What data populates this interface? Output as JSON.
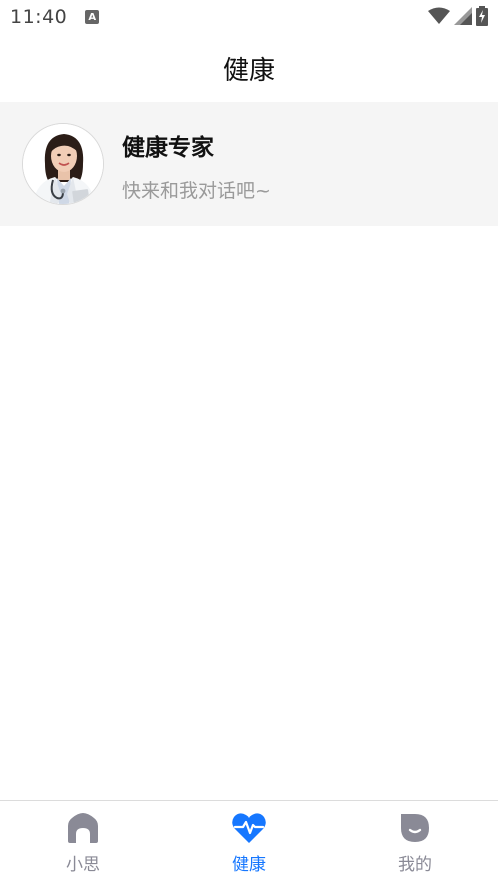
{
  "status_bar": {
    "time": "11:40",
    "notification_icon": "a-notification-icon",
    "wifi_icon": "wifi-icon",
    "signal_icon": "signal-icon",
    "battery_icon": "battery-charging-icon"
  },
  "header": {
    "title": "健康"
  },
  "chats": [
    {
      "name": "健康专家",
      "preview": "快来和我对话吧~",
      "avatar_icon": "doctor-avatar"
    }
  ],
  "bottom_nav": {
    "items": [
      {
        "label": "小思",
        "icon": "home-icon",
        "active": false
      },
      {
        "label": "健康",
        "icon": "heart-pulse-icon",
        "active": true
      },
      {
        "label": "我的",
        "icon": "profile-smile-icon",
        "active": false
      }
    ]
  },
  "colors": {
    "accent": "#1677ff",
    "inactive": "#8a8a96",
    "list_bg": "#f5f5f5"
  }
}
